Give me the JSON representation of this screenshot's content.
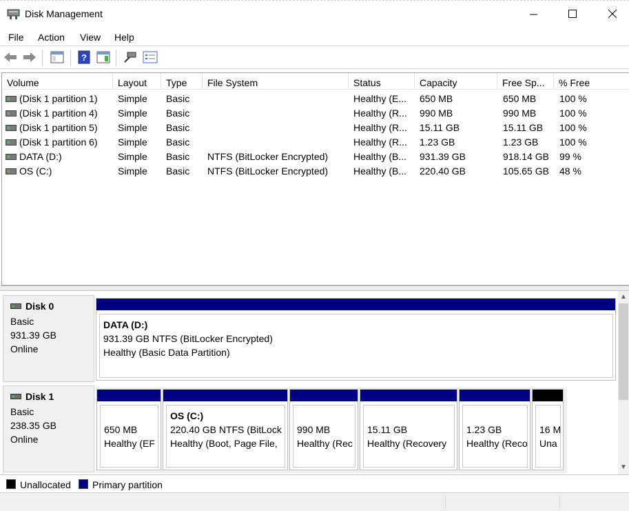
{
  "window": {
    "title": "Disk Management",
    "icons": {
      "app": "disk-management-icon",
      "minimize": "minimize-icon",
      "maximize": "maximize-icon",
      "close": "close-icon"
    }
  },
  "menu": [
    "File",
    "Action",
    "View",
    "Help"
  ],
  "toolbar": {
    "buttons": [
      "back-arrow-icon",
      "forward-arrow-icon",
      "show-hide-console-tree-icon",
      "help-icon",
      "show-action-pane-icon",
      "connect-disk-icon",
      "properties-checklist-icon"
    ]
  },
  "volumes": {
    "columns": [
      "Volume",
      "Layout",
      "Type",
      "File System",
      "Status",
      "Capacity",
      "Free Sp...",
      "% Free"
    ],
    "rows": [
      {
        "volume": "(Disk 1 partition 1)",
        "layout": "Simple",
        "type": "Basic",
        "fs": "",
        "status": "Healthy (E...",
        "capacity": "650 MB",
        "free": "650 MB",
        "pct": "100 %"
      },
      {
        "volume": "(Disk 1 partition 4)",
        "layout": "Simple",
        "type": "Basic",
        "fs": "",
        "status": "Healthy (R...",
        "capacity": "990 MB",
        "free": "990 MB",
        "pct": "100 %"
      },
      {
        "volume": "(Disk 1 partition 5)",
        "layout": "Simple",
        "type": "Basic",
        "fs": "",
        "status": "Healthy (R...",
        "capacity": "15.11 GB",
        "free": "15.11 GB",
        "pct": "100 %"
      },
      {
        "volume": "(Disk 1 partition 6)",
        "layout": "Simple",
        "type": "Basic",
        "fs": "",
        "status": "Healthy (R...",
        "capacity": "1.23 GB",
        "free": "1.23 GB",
        "pct": "100 %"
      },
      {
        "volume": "DATA (D:)",
        "layout": "Simple",
        "type": "Basic",
        "fs": "NTFS (BitLocker Encrypted)",
        "status": "Healthy (B...",
        "capacity": "931.39 GB",
        "free": "918.14 GB",
        "pct": "99 %"
      },
      {
        "volume": "OS (C:)",
        "layout": "Simple",
        "type": "Basic",
        "fs": "NTFS (BitLocker Encrypted)",
        "status": "Healthy (B...",
        "capacity": "220.40 GB",
        "free": "105.65 GB",
        "pct": "48 %"
      }
    ]
  },
  "disks": [
    {
      "name": "Disk 0",
      "type": "Basic",
      "size": "931.39 GB",
      "state": "Online",
      "partitions": [
        {
          "title": "DATA  (D:)",
          "line1": "931.39 GB NTFS (BitLocker Encrypted)",
          "line2": "Healthy (Basic Data Partition)",
          "kind": "primary"
        }
      ]
    },
    {
      "name": "Disk 1",
      "type": "Basic",
      "size": "238.35 GB",
      "state": "Online",
      "partitions": [
        {
          "title": "",
          "line1": "650 MB",
          "line2": "Healthy (EF",
          "kind": "primary"
        },
        {
          "title": "OS  (C:)",
          "line1": "220.40 GB NTFS (BitLock",
          "line2": "Healthy (Boot, Page File,",
          "kind": "primary"
        },
        {
          "title": "",
          "line1": "990 MB",
          "line2": "Healthy (Rec",
          "kind": "primary"
        },
        {
          "title": "",
          "line1": "15.11 GB",
          "line2": "Healthy (Recovery",
          "kind": "primary"
        },
        {
          "title": "",
          "line1": "1.23 GB",
          "line2": "Healthy (Reco",
          "kind": "primary"
        },
        {
          "title": "",
          "line1": "16 M",
          "line2": "Una",
          "kind": "unallocated"
        }
      ]
    }
  ],
  "legend": [
    {
      "label": "Unallocated",
      "color": "#000000"
    },
    {
      "label": "Primary partition",
      "color": "#000083"
    }
  ],
  "colors": {
    "primary": "#000083",
    "unallocated": "#000000"
  }
}
